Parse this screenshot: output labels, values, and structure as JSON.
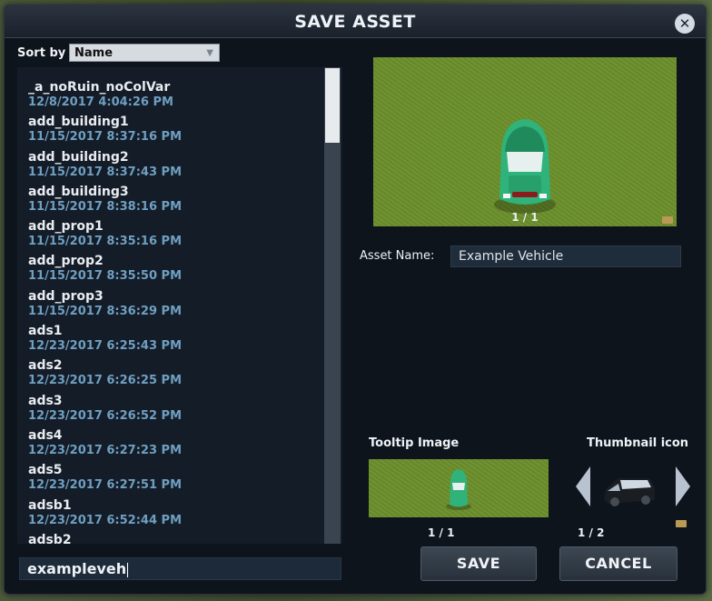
{
  "dialog": {
    "title": "SAVE ASSET",
    "close_icon": "close-icon"
  },
  "sort": {
    "label": "Sort by",
    "selected": "Name"
  },
  "assets": [
    {
      "name": "_a_noRuin_noColVar",
      "date": "12/8/2017 4:04:26 PM"
    },
    {
      "name": "add_building1",
      "date": "11/15/2017 8:37:16 PM"
    },
    {
      "name": "add_building2",
      "date": "11/15/2017 8:37:43 PM"
    },
    {
      "name": "add_building3",
      "date": "11/15/2017 8:38:16 PM"
    },
    {
      "name": "add_prop1",
      "date": "11/15/2017 8:35:16 PM"
    },
    {
      "name": "add_prop2",
      "date": "11/15/2017 8:35:50 PM"
    },
    {
      "name": "add_prop3",
      "date": "11/15/2017 8:36:29 PM"
    },
    {
      "name": "ads1",
      "date": "12/23/2017 6:25:43 PM"
    },
    {
      "name": "ads2",
      "date": "12/23/2017 6:26:25 PM"
    },
    {
      "name": "ads3",
      "date": "12/23/2017 6:26:52 PM"
    },
    {
      "name": "ads4",
      "date": "12/23/2017 6:27:23 PM"
    },
    {
      "name": "ads5",
      "date": "12/23/2017 6:27:51 PM"
    },
    {
      "name": "adsb1",
      "date": "12/23/2017 6:52:44 PM"
    },
    {
      "name": "adsb2",
      "date": ""
    }
  ],
  "filename": {
    "value": "exampleveh"
  },
  "preview": {
    "counter": "1 / 1"
  },
  "asset_name": {
    "label": "Asset Name:",
    "value": "Example Vehicle"
  },
  "tooltip": {
    "label": "Tooltip Image",
    "counter": "1 / 1"
  },
  "thumbnail": {
    "label": "Thumbnail icon",
    "counter": "1 / 2"
  },
  "buttons": {
    "save": "SAVE",
    "cancel": "CANCEL"
  },
  "colors": {
    "dialog_bg": "#0e141c",
    "date_text": "#6f9fc2",
    "grass": "#6b8f2c",
    "car": "#2fb37a"
  }
}
